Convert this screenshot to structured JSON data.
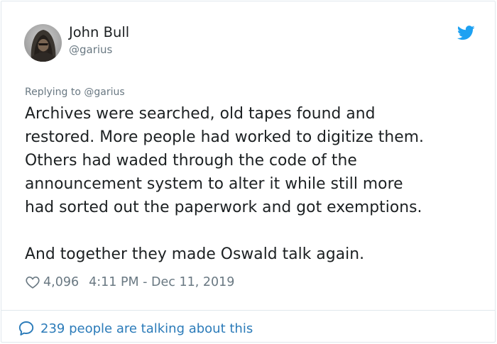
{
  "tweet": {
    "author_name": "John Bull",
    "author_handle": "@garius",
    "replying_prefix": "Replying to ",
    "replying_to": "@garius",
    "text_lines": [
      "Archives were searched, old tapes found and",
      "restored. More people had worked to digitize them.",
      "Others had waded through the code of the",
      "announcement system to alter it while still more",
      "had sorted out the paperwork and got exemptions.",
      "",
      "And together they made Oswald talk again."
    ],
    "likes": "4,096",
    "timestamp": "4:11 PM - Dec 11, 2019",
    "conversation_label": "239 people are talking about this"
  },
  "icons": {
    "brand": "twitter-bird-icon",
    "like": "heart-outline-icon",
    "reply": "speech-bubble-icon"
  },
  "colors": {
    "twitter_blue": "#1da1f2",
    "link_blue": "#2b7bb9",
    "muted_gray": "#697882",
    "text": "#1c2022",
    "border": "#e1e8ed"
  }
}
